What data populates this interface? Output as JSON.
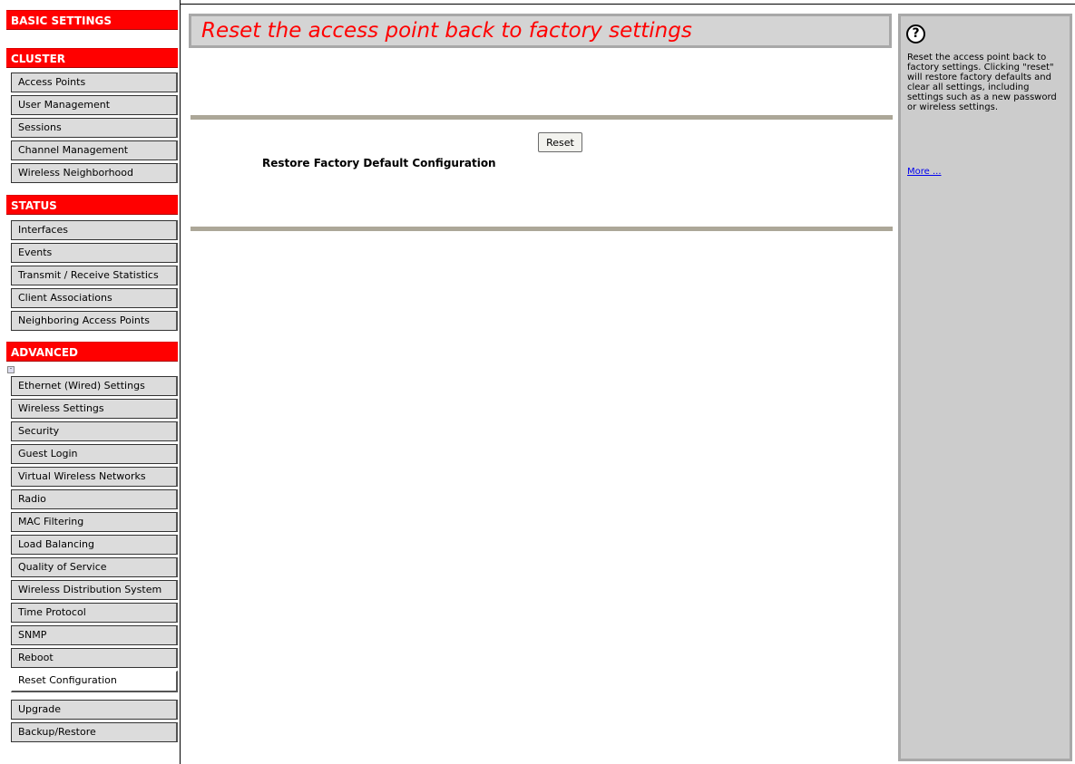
{
  "sidebar": {
    "basic_settings": "BASIC SETTINGS",
    "cluster": {
      "title": "CLUSTER",
      "items": [
        "Access Points",
        "User Management",
        "Sessions",
        "Channel Management",
        "Wireless Neighborhood"
      ]
    },
    "status": {
      "title": "STATUS",
      "items": [
        "Interfaces",
        "Events",
        "Transmit / Receive Statistics",
        "Client Associations",
        "Neighboring Access Points"
      ]
    },
    "advanced": {
      "title": "ADVANCED",
      "items": [
        "Ethernet (Wired) Settings",
        "Wireless Settings",
        "Security",
        "Guest Login",
        "Virtual Wireless Networks",
        "Radio",
        "MAC Filtering",
        "Load Balancing",
        "Quality of Service",
        "Wireless Distribution System",
        "Time Protocol",
        "SNMP",
        "Reboot",
        "Reset Configuration",
        "Upgrade",
        "Backup/Restore"
      ],
      "active_item": "Reset Configuration"
    }
  },
  "main": {
    "title": "Reset the access point back to factory settings",
    "reset_button_label": "Reset",
    "restore_label": "Restore Factory Default Configuration"
  },
  "help": {
    "text": "Reset the access point back to factory settings. Clicking \"reset\" will restore factory defaults and clear all settings, including settings such as a new password or wireless settings.",
    "more_link": "More ..."
  },
  "colors": {
    "section_header": "#ff0000",
    "title_text": "#ff0000",
    "link": "#0000ee"
  }
}
